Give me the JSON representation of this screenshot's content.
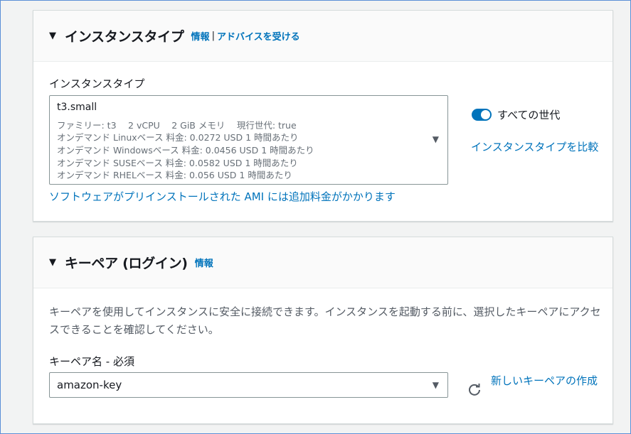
{
  "instance_panel": {
    "title": "インスタンスタイプ",
    "info_link": "情報",
    "separator": "|",
    "advice_link": "アドバイスを受ける",
    "field_label": "インスタンスタイプ",
    "selected": {
      "name": "t3.small",
      "lines": [
        "ファミリー: t3　 2 vCPU　 2 GiB メモリ　 現行世代: true",
        "オンデマンド Linuxベース 料金: 0.0272 USD 1 時間あたり",
        "オンデマンド Windowsベース 料金: 0.0456 USD 1 時間あたり",
        "オンデマンド SUSEベース 料金: 0.0582 USD 1 時間あたり",
        "オンデマンド RHELベース 料金: 0.056 USD 1 時間あたり"
      ]
    },
    "toggle_label": "すべての世代",
    "toggle_on": true,
    "compare_link": "インスタンスタイプを比較",
    "ami_note_link": "ソフトウェアがプリインストールされた AMI には追加料金がかかります"
  },
  "keypair_panel": {
    "title": "キーペア (ログイン)",
    "info_link": "情報",
    "description": "キーペアを使用してインスタンスに安全に接続できます。インスタンスを起動する前に、選択したキーペアにアクセスできることを確認してください。",
    "field_label": "キーペア名 - 必須",
    "selected_value": "amazon-key",
    "new_keypair_link": "新しいキーペアの作成"
  },
  "colors": {
    "link": "#0073bb",
    "toggle": "#0073bb",
    "header_bg": "#fafafa"
  },
  "icons": {
    "collapse": "caret-down-icon",
    "dropdown": "dropdown-arrow-icon",
    "refresh": "refresh-icon"
  }
}
